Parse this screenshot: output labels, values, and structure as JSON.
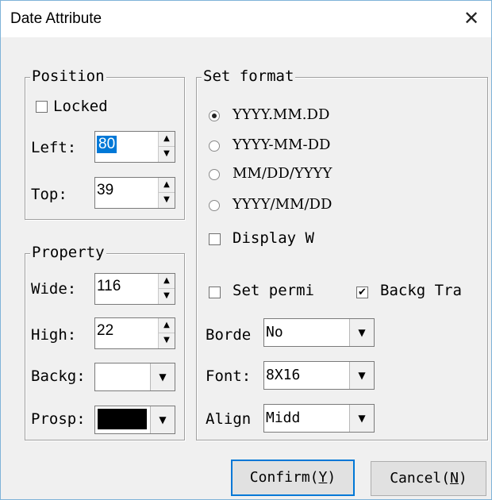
{
  "window": {
    "title": "Date Attribute",
    "close_glyph": "✕"
  },
  "position": {
    "title": "Position",
    "locked_label": "Locked",
    "locked": false,
    "left_label": "Left:",
    "left_value": "80",
    "top_label": "Top:",
    "top_value": "39"
  },
  "property": {
    "title": "Property",
    "wide_label": "Wide:",
    "wide_value": "116",
    "high_label": "High:",
    "high_value": "22",
    "backg_label": "Backg:",
    "backg_color": "#ffffff",
    "prosp_label": "Prosp:",
    "prosp_color": "#000000"
  },
  "format": {
    "title": "Set format",
    "options": [
      "YYYY.MM.DD",
      "YYYY-MM-DD",
      "MM/DD/YYYY",
      "YYYY/MM/DD"
    ],
    "selected_index": 0,
    "display_w_label": "Display W",
    "display_w_checked": false,
    "set_permi_label": "Set permi",
    "set_permi_checked": false,
    "backg_tra_label": "Backg Tra",
    "backg_tra_checked": true,
    "border_label": "Borde",
    "border_value": "No",
    "font_label": "Font:",
    "font_value": "8X16",
    "align_label": "Align",
    "align_value": "Midd"
  },
  "buttons": {
    "confirm_text": "Confirm(",
    "confirm_key": "Y",
    "cancel_text": "Cancel(",
    "cancel_key": "N",
    "close_paren": ")"
  },
  "icons": {
    "spin_up": "▲",
    "spin_down": "▼",
    "combo_arrow": "▼",
    "check": "✔"
  }
}
